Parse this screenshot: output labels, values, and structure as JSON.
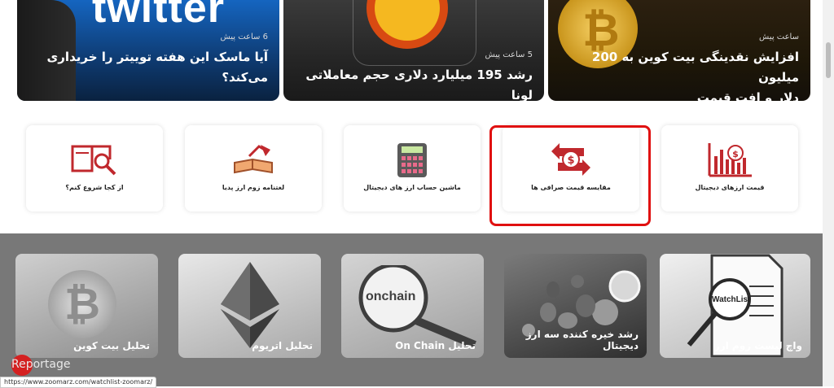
{
  "news": [
    {
      "time": "6 ساعت پیش",
      "title_line1": "آیا ماسک این هفته توییتر را خریداری",
      "title_line2": "می‌کند؟",
      "bg_word": "twitter"
    },
    {
      "time": "5 ساعت پیش",
      "title_line1": "رشد 195 میلیارد دلاری حجم معاملاتی لونا"
    },
    {
      "time": "ساعت پیش",
      "title_line1": "افزایش نقدینگی بیت کوین به 200 میلیون",
      "title_line2": "دلار و افت قیمت"
    }
  ],
  "tools": [
    {
      "label": "از کجا شروع کنم؟",
      "icon": "book-search-icon"
    },
    {
      "label": "لغتنامه زوم ارز پدیا",
      "icon": "lamp-book-icon"
    },
    {
      "label": "ماشین حساب ارز های دیجیتال",
      "icon": "calculator-icon"
    },
    {
      "label": "مقایسه قیمت صرافی ها",
      "icon": "exchange-compare-icon"
    },
    {
      "label": "قیمت ارزهای دیجیتال",
      "icon": "price-chart-icon"
    }
  ],
  "analysis": [
    {
      "label": "تحلیل بیت کوین",
      "icon": "bitcoin-icon"
    },
    {
      "label": "تحلیل اتریوم",
      "icon": "ethereum-icon"
    },
    {
      "label": "تحلیل On Chain",
      "icon": "onchain-magnifier-icon",
      "art_text": "onchain"
    },
    {
      "label": "رشد خیره کننده سه ارز دیجیتال",
      "icon": "coins-icon"
    },
    {
      "label": "واچ لیست زوم ارز",
      "icon": "watchlist-icon",
      "art_text": "WatchList"
    }
  ],
  "reportage": "Reportage",
  "status_url": "https://www.zoomarz.com/watchlist-zoomarz/",
  "colors": {
    "accent_red": "#e01010",
    "band_gray": "#787878"
  }
}
